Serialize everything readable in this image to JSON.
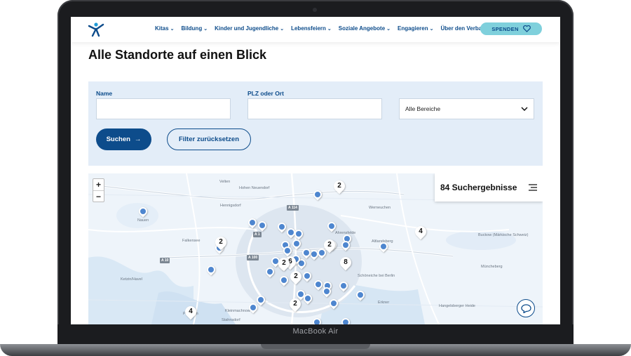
{
  "device": {
    "label": "MacBook Air"
  },
  "header": {
    "nav": [
      {
        "label": "Kitas"
      },
      {
        "label": "Bildung"
      },
      {
        "label": "Kinder und Jugendliche"
      },
      {
        "label": "Lebensfeiern"
      },
      {
        "label": "Soziale Angebote"
      },
      {
        "label": "Engagieren"
      },
      {
        "label": "Über den Verband"
      }
    ],
    "donate_label": "SPENDEN"
  },
  "page": {
    "title": "Alle Standorte auf einen Blick"
  },
  "filter": {
    "name_label": "Name",
    "plz_label": "PLZ oder Ort",
    "area_select": "Alle Bereiche",
    "search_button": "Suchen",
    "reset_button": "Filter zurücksetzen"
  },
  "map": {
    "results_label": "84 Suchergebnisse",
    "zoom_in": "+",
    "zoom_out": "−",
    "places": [
      "Velten",
      "Hohen Neuendorf",
      "Hennigsdorf",
      "Ahrensfelde",
      "Werneuchen",
      "Nauen",
      "Falkensee",
      "Altlandsberg",
      "Buckow (Märkische Schweiz)",
      "Müncheberg",
      "Ketzin/Havel",
      "Schöneiche bei Berlin",
      "Erkner",
      "Potsdam",
      "Kleinmachnow",
      "Stahnsdorf",
      "Hangelsberger Heide"
    ],
    "roads": [
      "A 114",
      "A 10",
      "A 100",
      "A 1"
    ],
    "cluster_counts": [
      "2",
      "4",
      "2",
      "2",
      "8",
      "6",
      "2",
      "2",
      "2",
      "4"
    ]
  },
  "colors": {
    "brand": "#0d4c8b",
    "accent": "#7fd0dc",
    "panel": "#e3edf8",
    "marker": "#4e86cf"
  }
}
